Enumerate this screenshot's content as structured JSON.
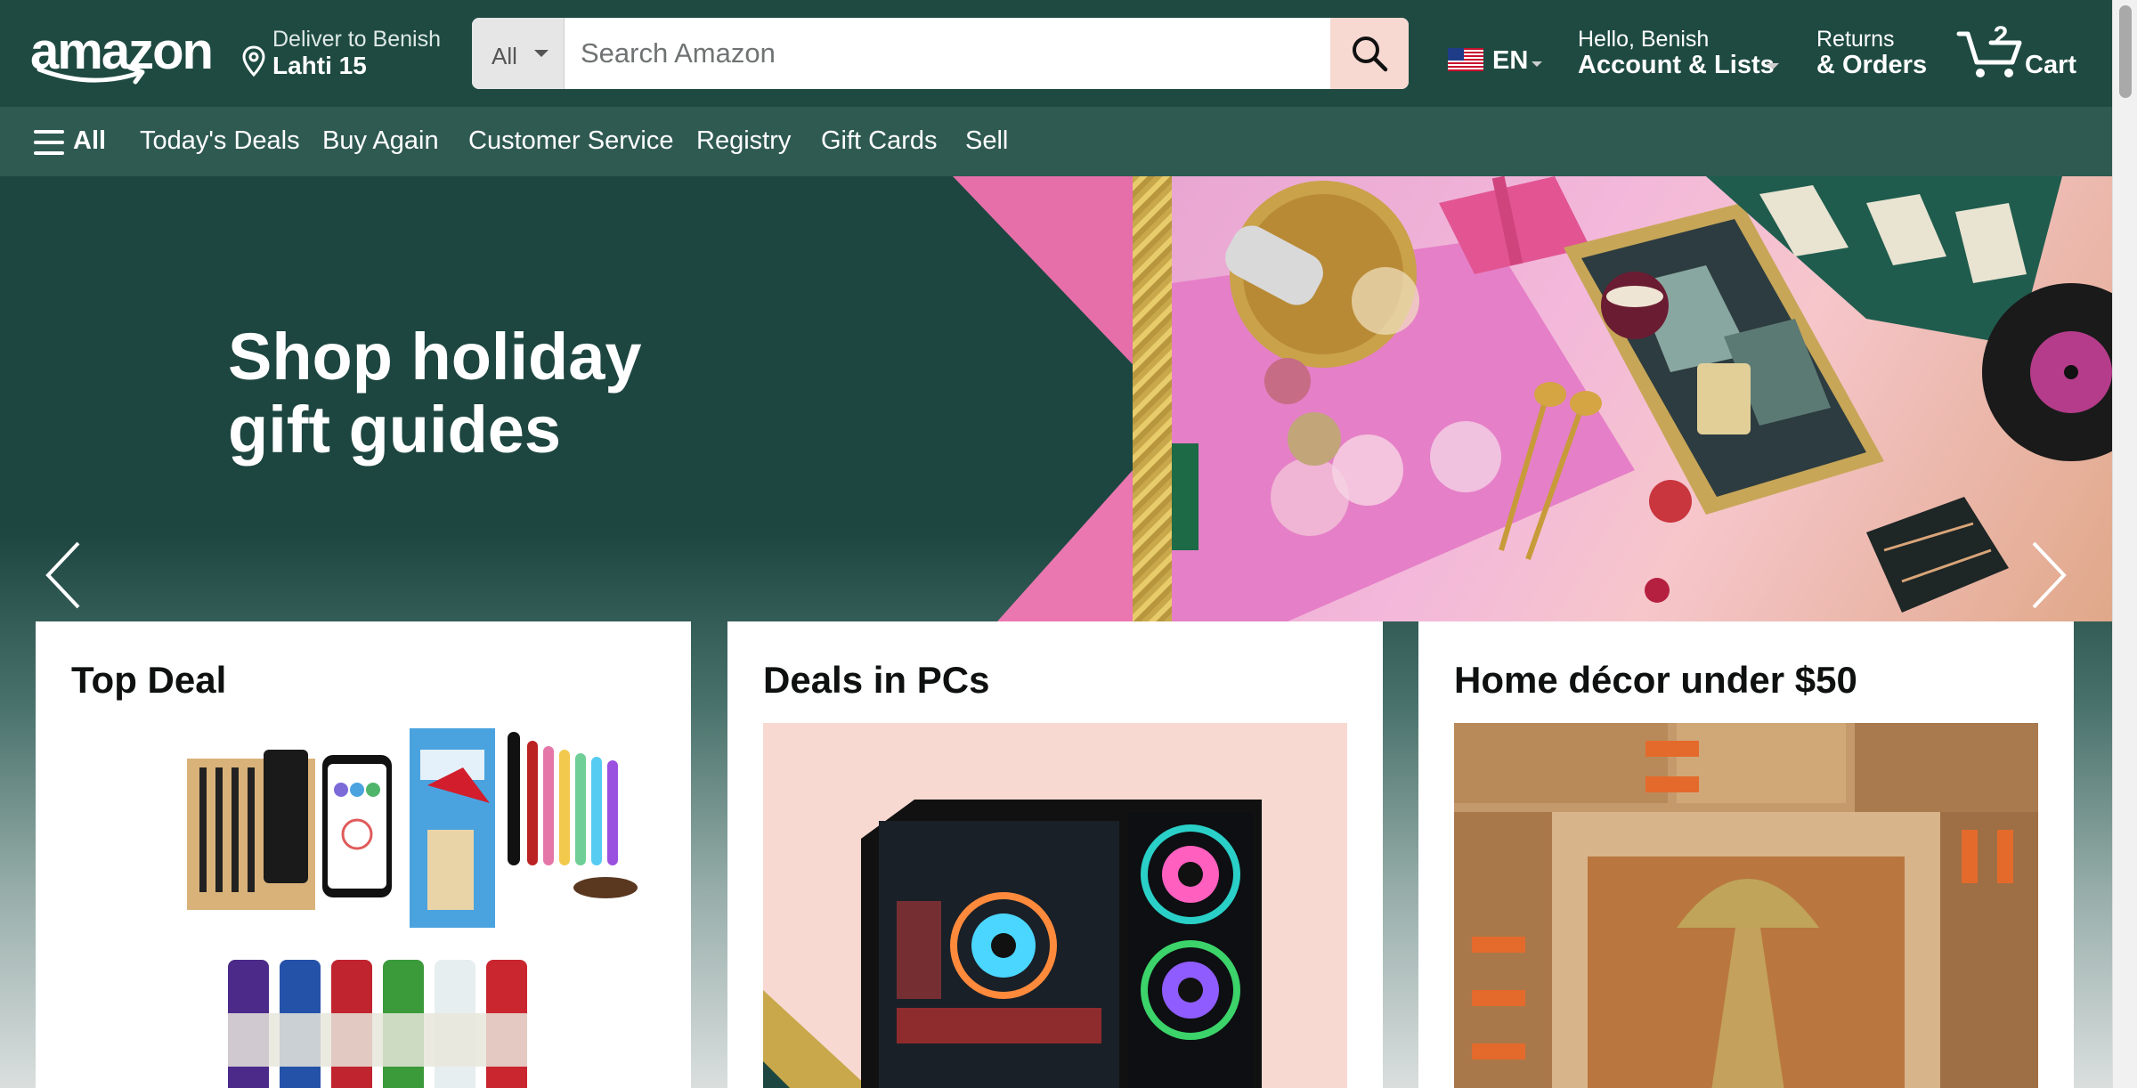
{
  "header": {
    "logo_text": "amazon",
    "deliver_line1": "Deliver to Benish",
    "deliver_line2": "Lahti 15",
    "search_category": "All",
    "search_placeholder": "Search Amazon",
    "language": "EN",
    "account_line1": "Hello, Benish",
    "account_line2": "Account & Lists",
    "returns_line1": "Returns",
    "returns_line2": "& Orders",
    "cart_count": "2",
    "cart_label": "Cart"
  },
  "nav": {
    "all_label": "All",
    "items": [
      "Today's Deals",
      "Buy Again",
      "Customer Service",
      "Registry",
      "Gift Cards",
      "Sell"
    ]
  },
  "hero": {
    "title_line1": "Shop holiday",
    "title_line2": "gift guides"
  },
  "cards": [
    {
      "title": "Top Deal"
    },
    {
      "title": "Deals in PCs"
    },
    {
      "title": "Home décor under $50"
    }
  ],
  "colors": {
    "header_bg": "#1e4a41",
    "nav_bg": "#2f5a52",
    "hero_bg": "#1d4640",
    "search_button_bg": "#f7d9d1"
  },
  "icons": {
    "search": "search-icon",
    "location": "location-pin-icon",
    "cart": "cart-icon",
    "menu": "hamburger-menu-icon",
    "flag": "us-flag-icon"
  }
}
